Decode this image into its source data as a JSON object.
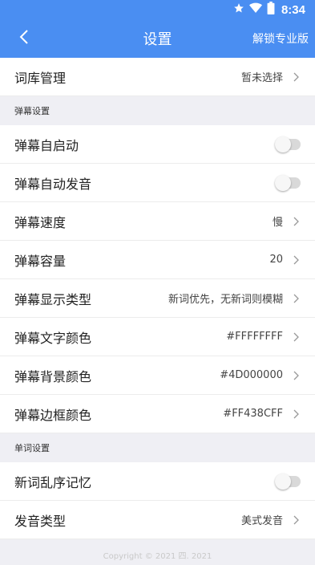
{
  "status": {
    "time": "8:34",
    "icons": [
      "star-icon",
      "wifi-icon",
      "battery-icon"
    ]
  },
  "header": {
    "title": "设置",
    "back_icon": "chevron-left-icon",
    "unlock": "解锁专业版"
  },
  "colors": {
    "primary": "#4a8ef2",
    "background": "#efeff4"
  },
  "dict": {
    "label": "词库管理",
    "value": "暂未选择"
  },
  "danmaku": {
    "section_title": "弹幕设置",
    "auto_start": {
      "label": "弹幕自启动",
      "enabled": false
    },
    "auto_speak": {
      "label": "弹幕自动发音",
      "enabled": false
    },
    "speed": {
      "label": "弹幕速度",
      "value": "慢"
    },
    "capacity": {
      "label": "弹幕容量",
      "value": "20"
    },
    "display_type": {
      "label": "弹幕显示类型",
      "value": "新词优先，无新词则模糊"
    },
    "text_color": {
      "label": "弹幕文字颜色",
      "value": "#FFFFFFFF"
    },
    "bg_color": {
      "label": "弹幕背景颜色",
      "value": "#4D000000"
    },
    "border_color": {
      "label": "弹幕边框颜色",
      "value": "#FF438CFF"
    }
  },
  "words": {
    "section_title": "单词设置",
    "shuffle": {
      "label": "新词乱序记忆",
      "enabled": false
    },
    "pron_type": {
      "label": "发音类型",
      "value": "美式发音"
    }
  },
  "footer": {
    "copyright": "Copyright © 2021 四. 2021"
  }
}
